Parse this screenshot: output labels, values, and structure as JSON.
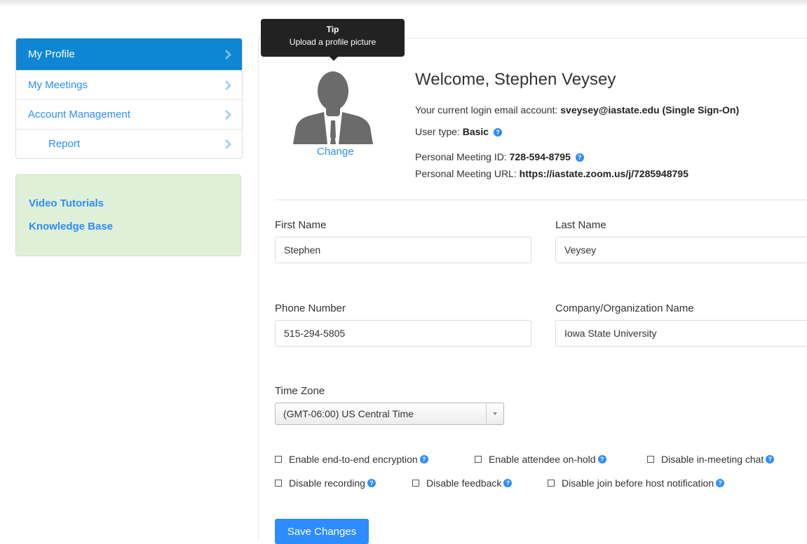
{
  "sidebar": {
    "items": [
      {
        "label": "My Profile",
        "active": true
      },
      {
        "label": "My Meetings"
      },
      {
        "label": "Account Management"
      },
      {
        "label": "Report"
      }
    ]
  },
  "help": {
    "video_tutorials": "Video Tutorials",
    "knowledge_base": "Knowledge Base"
  },
  "tooltip": {
    "title": "Tip",
    "text": "Upload a profile picture"
  },
  "profile": {
    "change_label": "Change",
    "welcome": "Welcome, Stephen Veysey",
    "login_prefix": "Your current login email account: ",
    "login_email": "sveysey@iastate.edu (Single Sign-On)",
    "user_type_prefix": "User type: ",
    "user_type": "Basic",
    "pmi_prefix": "Personal Meeting ID: ",
    "pmi": "728-594-8795",
    "pmu_prefix": "Personal Meeting URL: ",
    "pmu": "https://iastate.zoom.us/j/7285948795"
  },
  "form": {
    "first_name_label": "First Name",
    "first_name": "Stephen",
    "last_name_label": "Last Name",
    "last_name": "Veysey",
    "phone_label": "Phone Number",
    "phone": "515-294-5805",
    "company_label": "Company/Organization Name",
    "company": "Iowa State University",
    "timezone_label": "Time Zone",
    "timezone": "(GMT-06:00) US Central Time"
  },
  "options": {
    "e2e": "Enable end-to-end encryption",
    "onhold": "Enable attendee on-hold",
    "disable_chat": "Disable in-meeting chat",
    "disable_recording": "Disable recording",
    "disable_feedback": "Disable feedback",
    "disable_jbh": "Disable join before host notification"
  },
  "actions": {
    "save": "Save Changes"
  },
  "colors": {
    "accent": "#2d8cff",
    "active_nav": "#0e86d4",
    "help_box": "#dff0d8",
    "tooltip": "#222222"
  }
}
